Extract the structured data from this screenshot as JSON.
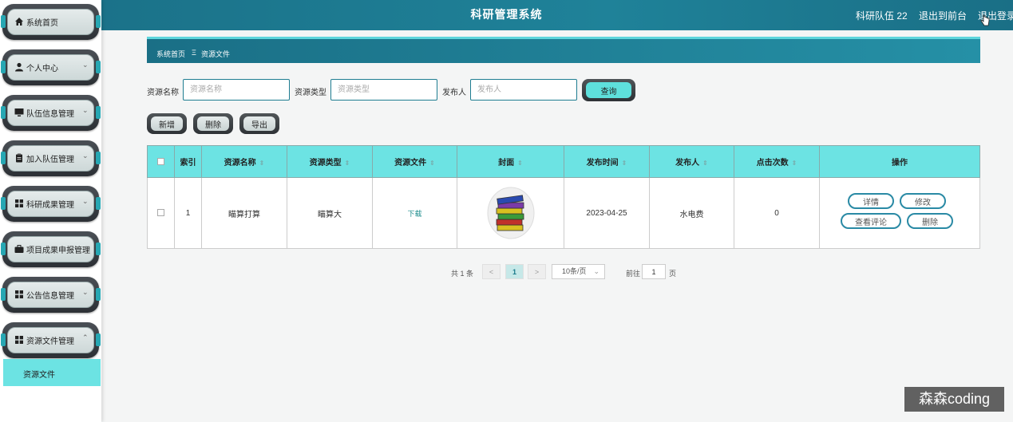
{
  "header": {
    "title": "科研管理系统",
    "user": "科研队伍 22",
    "front_link": "退出到前台",
    "logout_link": "退出登录"
  },
  "sidebar": {
    "items": [
      {
        "label": "系统首页",
        "icon": "home-icon"
      },
      {
        "label": "个人中心",
        "icon": "user-icon",
        "chevron": "⌄"
      },
      {
        "label": "队伍信息管理",
        "icon": "monitor-icon",
        "chevron": "⌄"
      },
      {
        "label": "加入队伍管理",
        "icon": "clipboard-icon",
        "chevron": "⌄"
      },
      {
        "label": "科研成果管理",
        "icon": "grid-icon",
        "chevron": "⌄"
      },
      {
        "label": "项目成果申报管理",
        "icon": "briefcase-icon"
      },
      {
        "label": "公告信息管理",
        "icon": "grid-icon",
        "chevron": "⌄"
      },
      {
        "label": "资源文件管理",
        "icon": "grid-icon",
        "chevron": "⌃"
      }
    ],
    "submenu": {
      "label": "资源文件"
    }
  },
  "breadcrumb": {
    "home": "系统首页",
    "separator": "Ξ",
    "current": "资源文件"
  },
  "search": {
    "name_label": "资源名称",
    "name_placeholder": "资源名称",
    "type_label": "资源类型",
    "type_placeholder": "资源类型",
    "publisher_label": "发布人",
    "publisher_placeholder": "发布人",
    "query_button": "查询"
  },
  "toolbar": {
    "add": "新增",
    "delete": "删除",
    "export": "导出"
  },
  "table": {
    "columns": [
      "索引",
      "资源名称",
      "资源类型",
      "资源文件",
      "封面",
      "发布时间",
      "发布人",
      "点击次数",
      "操作"
    ],
    "rows": [
      {
        "index": "1",
        "name": "瞄算打算",
        "type": "瞄算大",
        "file": "下载",
        "time": "2023-04-25",
        "publisher": "水电费",
        "clicks": "0"
      }
    ],
    "actions": {
      "detail": "详情",
      "edit": "修改",
      "comments": "查看评论",
      "delete": "删除"
    }
  },
  "pagination": {
    "total": "共 1 条",
    "prev": "<",
    "current": "1",
    "next": ">",
    "page_size": "10条/页",
    "goto_label": "前往",
    "goto_value": "1",
    "page_label": "页"
  },
  "watermark": "森森coding",
  "colors": {
    "primary": "#1f7d91",
    "accent": "#6ce3e3",
    "topbar": "#1a6f86"
  }
}
